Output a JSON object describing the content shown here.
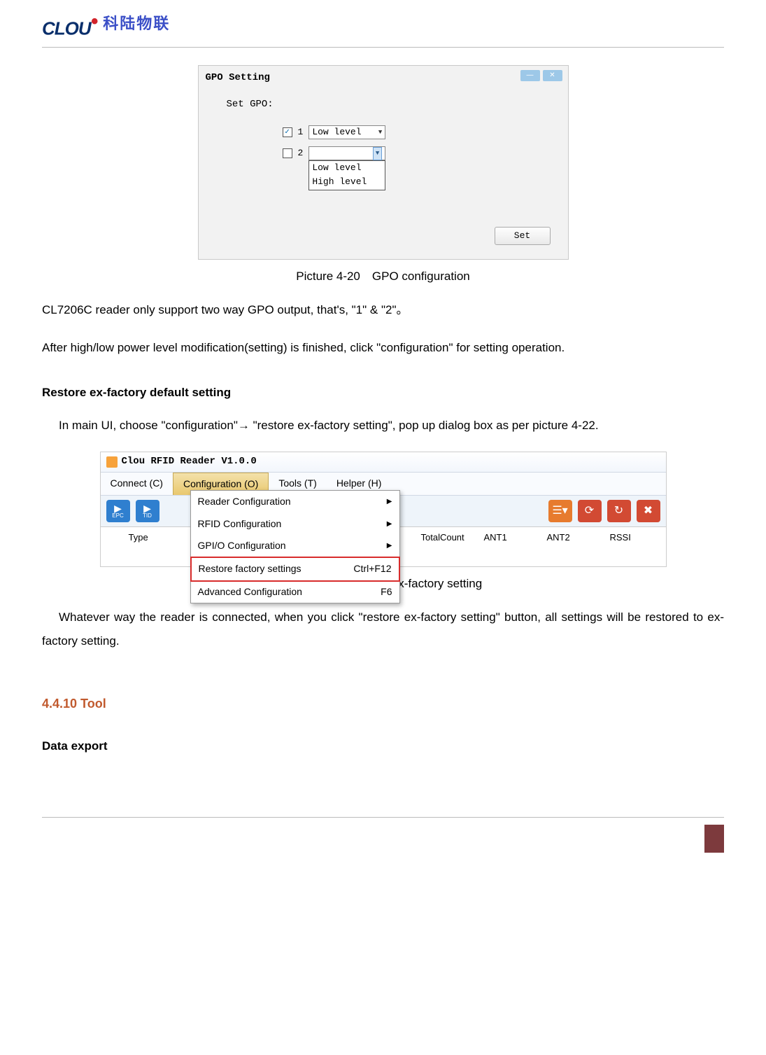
{
  "header": {
    "logo_text": "CLOU",
    "logo_cn": "科陆物联"
  },
  "fig1": {
    "window_title": "GPO Setting",
    "set_label": "Set GPO:",
    "row1_num": "1",
    "row1_value": "Low level",
    "row2_num": "2",
    "dropdown_opt1": "Low level",
    "dropdown_opt2": "High level",
    "set_btn": "Set",
    "caption": "Picture 4-20 GPO configuration"
  },
  "para1": "CL7206C reader only support two way GPO output, that's, \"1\" & \"2\"。",
  "para2": "After high/low power level modification(setting) is finished, click \"configuration\" for setting operation.",
  "section_restore": "Restore ex-factory default setting",
  "para3": "In main UI, choose \"configuration\"→ \"restore ex-factory setting\", pop up dialog box as per picture 4-22.",
  "fig2": {
    "app_title": "Clou RFID Reader V1.0.0",
    "menus": {
      "connect": "Connect (C)",
      "config": "Configuration (O)",
      "tools": "Tools (T)",
      "helper": "Helper (H)"
    },
    "dropdown": {
      "reader": "Reader Configuration",
      "rfid": "RFID Configuration",
      "gpio": "GPI/O Configuration",
      "restore": "Restore factory settings",
      "restore_key": "Ctrl+F12",
      "advanced": "Advanced Configuration",
      "advanced_key": "F6"
    },
    "toolbar_epc": "EPC",
    "toolbar_tid": "TID",
    "table": {
      "type": "Type",
      "total": "TotalCount",
      "ant1": "ANT1",
      "ant2": "ANT2",
      "rssi": "RSSI"
    },
    "caption": "Picture 4-22 restore ex-factory setting"
  },
  "para4": "Whatever way the reader is connected, when you click \"restore ex-factory setting\" button, all settings will be restored to ex-factory setting.",
  "section_4410": "4.4.10 Tool",
  "section_data_export": "Data export"
}
